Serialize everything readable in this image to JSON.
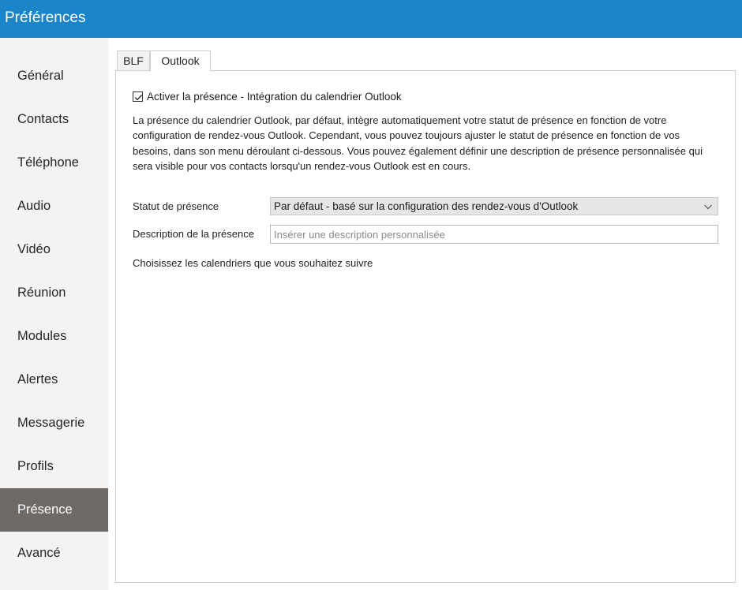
{
  "window": {
    "title": "Préférences"
  },
  "sidebar": {
    "items": [
      {
        "label": "Général"
      },
      {
        "label": "Contacts"
      },
      {
        "label": "Téléphone"
      },
      {
        "label": "Audio"
      },
      {
        "label": "Vidéo"
      },
      {
        "label": "Réunion"
      },
      {
        "label": "Modules"
      },
      {
        "label": "Alertes"
      },
      {
        "label": "Messagerie"
      },
      {
        "label": "Profils"
      },
      {
        "label": "Présence"
      },
      {
        "label": "Avancé"
      }
    ],
    "active_item": "Présence"
  },
  "tabs": [
    {
      "label": "BLF"
    },
    {
      "label": "Outlook"
    }
  ],
  "active_tab": "Outlook",
  "outlook": {
    "enable_checkbox": {
      "label": "Activer la présence - Intégration du calendrier Outlook",
      "checked": true
    },
    "description": "La présence du calendrier Outlook, par défaut, intègre automatiquement votre statut de présence en fonction de votre configuration de rendez-vous Outlook. Cependant, vous pouvez toujours ajuster le statut de présence en fonction de vos besoins, dans son menu déroulant ci-dessous. Vous pouvez également définir une description de présence personnalisée qui sera visible pour vos contacts lorsqu'un rendez-vous Outlook est en cours.",
    "status_label": "Statut de présence",
    "status_value": "Par défaut - basé sur la configuration des rendez-vous d'Outlook",
    "presence_description_label": "Description de la présence",
    "presence_description_value": "",
    "presence_description_placeholder": "Insérer une description personnalisée",
    "calendars_text": "Choisissez les calendriers que vous souhaitez suivre"
  },
  "colors": {
    "titlebar": "#1a85c8",
    "sidebar_bg": "#f3f3f3",
    "active_nav": "#6d6a67"
  }
}
